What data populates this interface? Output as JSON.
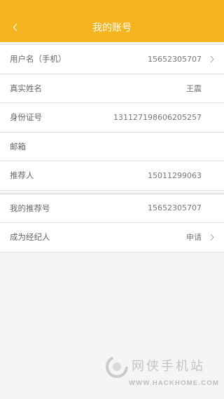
{
  "header": {
    "title": "我的账号",
    "back_icon": "chevron-left-icon",
    "bg_color": "#f5b41d"
  },
  "account_rows": [
    {
      "label": "用户名（手机）",
      "value": "15652305707",
      "chevron": true
    },
    {
      "label": "真实姓名",
      "value": "王震",
      "chevron": false
    },
    {
      "label": "身份证号",
      "value": "131127198606205257",
      "chevron": false
    },
    {
      "label": "邮箱",
      "value": "",
      "chevron": false
    },
    {
      "label": "推荐人",
      "value": "15011299063",
      "chevron": false
    }
  ],
  "agent_rows": [
    {
      "label": "我的推荐号",
      "value": "15652305707",
      "chevron": false
    },
    {
      "label": "成为经纪人",
      "value": "申请",
      "chevron": true
    }
  ],
  "watermark": {
    "cn": "网侠手机站",
    "en": "WWW.HACKHOME.COM"
  }
}
